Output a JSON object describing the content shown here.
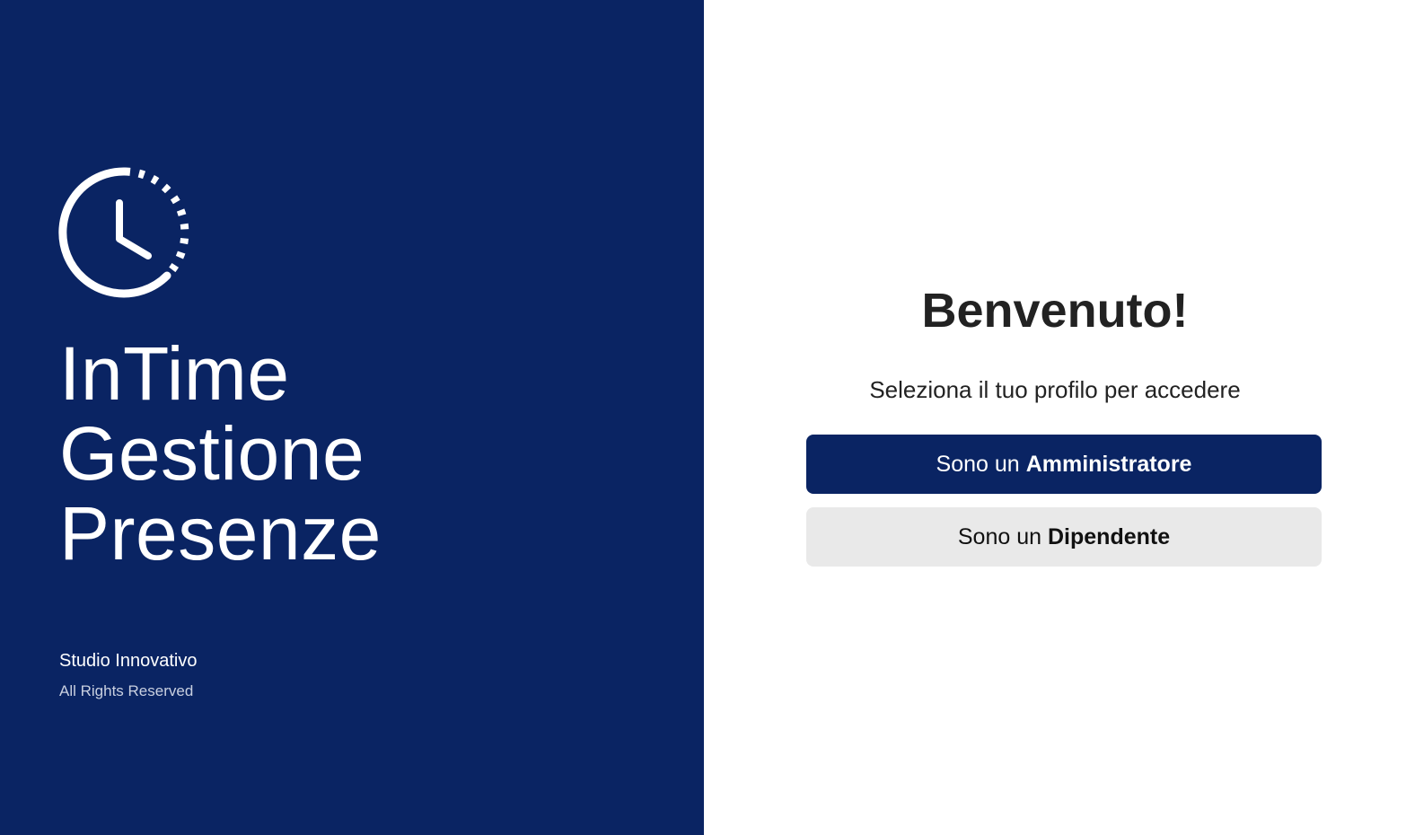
{
  "brand": {
    "title_lines": [
      "InTime",
      "Gestione",
      "Presenze"
    ],
    "company": "Studio Innovativo",
    "rights": "All Rights Reserved",
    "logo_icon": "clock-icon",
    "primary_color": "#0a2463"
  },
  "login": {
    "heading": "Benvenuto!",
    "subtitle": "Seleziona il tuo profilo per accedere",
    "admin_button": {
      "prefix": "Sono un",
      "role": "Amministratore"
    },
    "employee_button": {
      "prefix": "Sono un",
      "role": "Dipendente"
    }
  }
}
